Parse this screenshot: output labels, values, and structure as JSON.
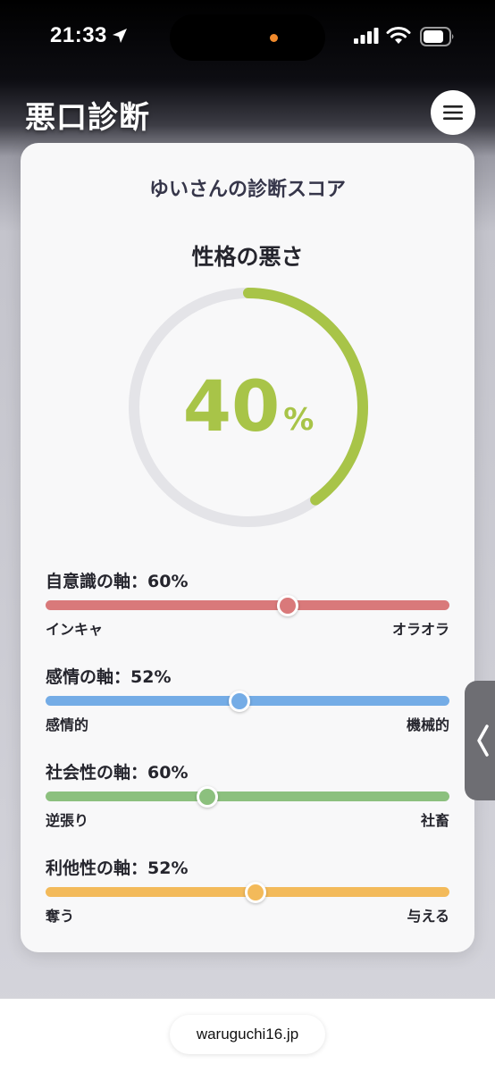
{
  "status_bar": {
    "time": "21:33",
    "icons": [
      "location-arrow-icon",
      "cellular-signal-icon",
      "wifi-icon",
      "battery-icon"
    ]
  },
  "header": {
    "title": "悪口診断",
    "menu_icon": "hamburger-menu-icon"
  },
  "card": {
    "heading": "ゆいさんの診断スコア",
    "gauge": {
      "title": "性格の悪さ",
      "value": "40",
      "unit": "%",
      "fraction": 0.4,
      "color": "#a8c448",
      "track_color": "#e4e4e8"
    },
    "axes": [
      {
        "title": "自意識の軸：60%",
        "value": 0.6,
        "left_label": "インキャ",
        "right_label": "オラオラ",
        "color": "#d9797a"
      },
      {
        "title": "感情の軸：52%",
        "value": 0.48,
        "left_label": "感情的",
        "right_label": "機械的",
        "color": "#74ace6"
      },
      {
        "title": "社会性の軸：60%",
        "value": 0.4,
        "left_label": "逆張り",
        "right_label": "社畜",
        "color": "#8cc07e"
      },
      {
        "title": "利他性の軸：52%",
        "value": 0.52,
        "left_label": "奪う",
        "right_label": "与える",
        "color": "#f3ba5a"
      }
    ]
  },
  "side_handle": {
    "icon": "chevron-left-icon"
  },
  "bottom_bar": {
    "url": "waruguchi16.jp"
  }
}
